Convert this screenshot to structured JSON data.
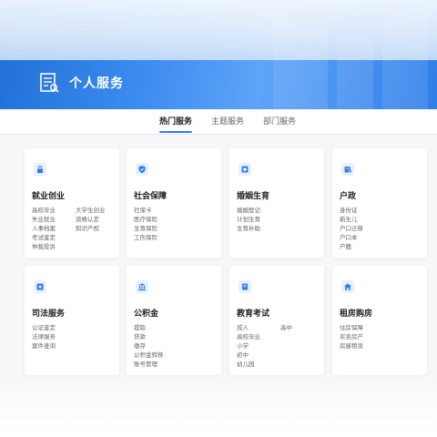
{
  "banner": {
    "title": "个人服务",
    "icon": "document-icon"
  },
  "tabs": [
    {
      "label": "热门服务",
      "active": true
    },
    {
      "label": "主题服务",
      "active": false
    },
    {
      "label": "部门服务",
      "active": false
    }
  ],
  "colors": {
    "accent": "#2f7ee8",
    "banner": "#3d8cf0",
    "icon_bg": "#e7f0fd"
  },
  "cards": [
    {
      "title": "就业创业",
      "icon": "lock-icon",
      "items": [
        "高校毕业",
        "大学生创业",
        "失业就业",
        "资格认定",
        "人事档案",
        "知识产权",
        "考试鉴定",
        "",
        "仲裁投诉",
        ""
      ]
    },
    {
      "title": "社会保障",
      "icon": "shield-icon",
      "items": [
        "社保卡",
        "",
        "医疗保险",
        "",
        "生育保险",
        "",
        "工伤保险",
        ""
      ]
    },
    {
      "title": "婚姻生育",
      "icon": "heart-icon",
      "items": [
        "婚姻登记",
        "",
        "计划生育",
        "",
        "生育补助",
        ""
      ]
    },
    {
      "title": "户政",
      "icon": "household-icon",
      "items": [
        "身份证",
        "",
        "新生儿",
        "",
        "户口迁移",
        "",
        "户口本",
        "",
        "户籍",
        ""
      ]
    },
    {
      "title": "司法服务",
      "icon": "justice-icon",
      "items": [
        "公证鉴定",
        "",
        "法律服务",
        "",
        "案件查询",
        ""
      ]
    },
    {
      "title": "公积金",
      "icon": "bank-icon",
      "items": [
        "提取",
        "",
        "贷款",
        "",
        "缴存",
        "",
        "公积金转移",
        "",
        "账号管理",
        ""
      ]
    },
    {
      "title": "教育考试",
      "icon": "book-icon",
      "items": [
        "成人",
        "高中",
        "高校毕业",
        "",
        "小学",
        "",
        "初中",
        "",
        "幼儿园",
        ""
      ]
    },
    {
      "title": "租房购房",
      "icon": "house-icon",
      "items": [
        "住房保障",
        "",
        "买卖房产",
        "",
        "房屋租赁",
        ""
      ]
    }
  ]
}
